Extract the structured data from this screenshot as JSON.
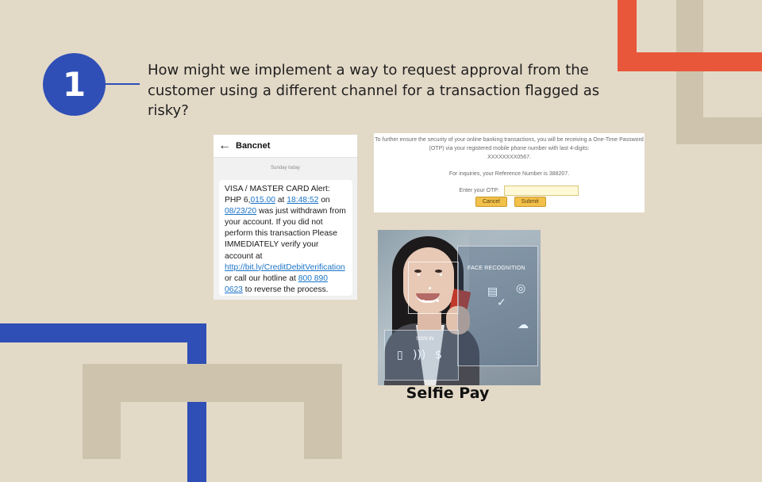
{
  "slide": {
    "number": "1",
    "question": "How might we implement a way to request approval from the customer using a different channel for a transaction flagged as risky?"
  },
  "sms": {
    "sender": "Bancnet",
    "date": "Sunday today",
    "msg_part1": "VISA / MASTER CARD Alert: PHP 6,",
    "amount_link": "015.00",
    "msg_part2": " at ",
    "time_link": "18:48:52",
    "msg_part3": " on ",
    "date_link": "08/23/20",
    "msg_part4": " was just withdrawn from your account. If you did not perform this transaction Please IMMEDIATELY verify your account at ",
    "url_link": "http://bit.ly/CreditDebitVerification",
    "msg_part5": " or call our hotline at  ",
    "hotline_link": "800 890 0623",
    "msg_part6": " to reverse the process."
  },
  "otp": {
    "line1": "To further ensure the security of your online banking transactions, you will be receiving a One-Time Password (OTP) via your registered mobile phone number with last 4-digits:",
    "masked_number": "XXXXXXXX0567.",
    "inquiry": "For inquiries, your Reference Number is 388207.",
    "label": "Enter your OTP:",
    "input_value": "",
    "cancel_label": "Cancel",
    "submit_label": "Submit"
  },
  "selfie": {
    "overlay_label": "FACE RECOGNITION",
    "sign_label": "SIGN IN",
    "caption": "Selfie Pay"
  },
  "colors": {
    "background": "#e3d9c7",
    "accent_blue": "#2f4fb6",
    "accent_orange": "#e8573a",
    "deco_beige": "#cec3ad"
  }
}
